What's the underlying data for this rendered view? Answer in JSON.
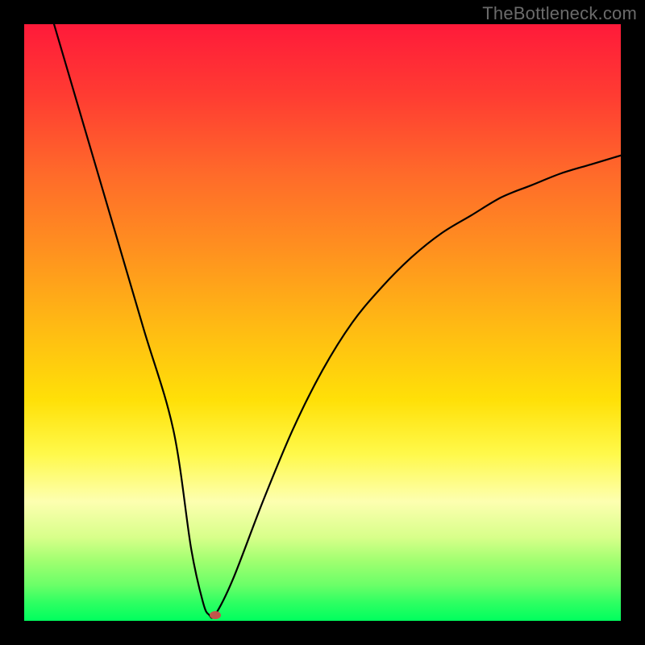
{
  "watermark": "TheBottleneck.com",
  "colors": {
    "top": "#ff1a3a",
    "mid": "#ffe008",
    "bottom": "#00ff5e",
    "curve": "#000000",
    "marker": "#c1564b",
    "frame": "#000000"
  },
  "chart_data": {
    "type": "line",
    "title": "",
    "xlabel": "",
    "ylabel": "",
    "xlim": [
      0,
      100
    ],
    "ylim": [
      0,
      100
    ],
    "grid": false,
    "legend": false,
    "series": [
      {
        "name": "bottleneck-curve",
        "x": [
          5,
          10,
          15,
          20,
          25,
          28,
          30,
          31,
          32,
          35,
          40,
          45,
          50,
          55,
          60,
          65,
          70,
          75,
          80,
          85,
          90,
          95,
          100
        ],
        "y": [
          100,
          83,
          66,
          49,
          32,
          12,
          3,
          1,
          1,
          7,
          20,
          32,
          42,
          50,
          56,
          61,
          65,
          68,
          71,
          73,
          75,
          76.5,
          78
        ]
      }
    ],
    "annotations": [
      {
        "type": "point",
        "name": "optimal-marker",
        "x": 32,
        "y": 1
      }
    ],
    "background_gradient": {
      "direction": "vertical",
      "stops": [
        {
          "pos": 0.0,
          "color": "#ff1a3a"
        },
        {
          "pos": 0.5,
          "color": "#ffe008"
        },
        {
          "pos": 1.0,
          "color": "#00ff5e"
        }
      ]
    }
  }
}
